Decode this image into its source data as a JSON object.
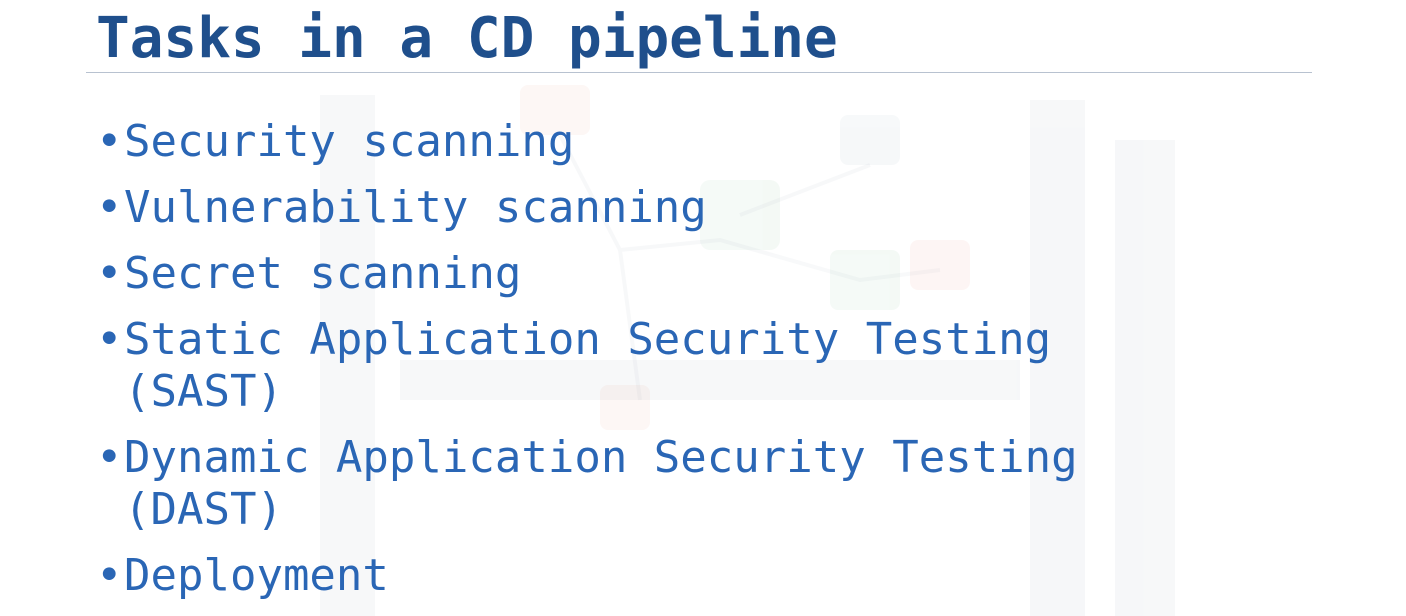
{
  "slide": {
    "title": "Tasks in a CD pipeline",
    "bullet_glyph": "•",
    "bullets": [
      {
        "line1": "Security scanning",
        "line2": ""
      },
      {
        "line1": "Vulnerability scanning",
        "line2": ""
      },
      {
        "line1": "Secret scanning",
        "line2": ""
      },
      {
        "line1": "Static Application Security Testing",
        "line2": "(SAST)"
      },
      {
        "line1": "Dynamic Application Security Testing",
        "line2": "(DAST)"
      },
      {
        "line1": "Deployment",
        "line2": ""
      }
    ]
  },
  "colors": {
    "title": "#1f4f8c",
    "bullet_text": "#2a66b5",
    "rule": "#b8c2d0"
  }
}
